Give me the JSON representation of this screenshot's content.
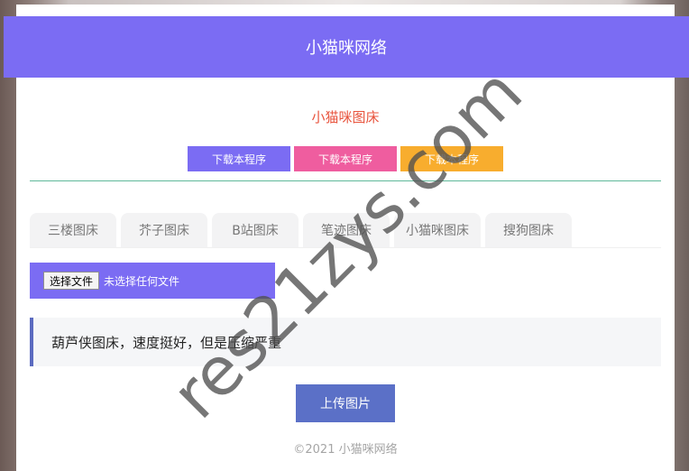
{
  "header": {
    "title": "小猫咪网络"
  },
  "subtitle": "小猫咪图床",
  "download_buttons": [
    {
      "label": "下载本程序",
      "color": "#7b6cf3"
    },
    {
      "label": "下载本程序",
      "color": "#ef5d9f"
    },
    {
      "label": "下载本程序",
      "color": "#f8ad2e"
    }
  ],
  "tabs": [
    "三楼图床",
    "芥子图床",
    "B站图床",
    "笔迹图床",
    "小猫咪图床",
    "搜狗图床"
  ],
  "file_input": {
    "button_label": "选择文件",
    "status": "未选择任何文件"
  },
  "notice": "葫芦侠图床，速度挺好，但是压缩严重",
  "upload_button": "上传图片",
  "footer": "©2021 小猫咪网络",
  "watermark": "res21zys.com"
}
